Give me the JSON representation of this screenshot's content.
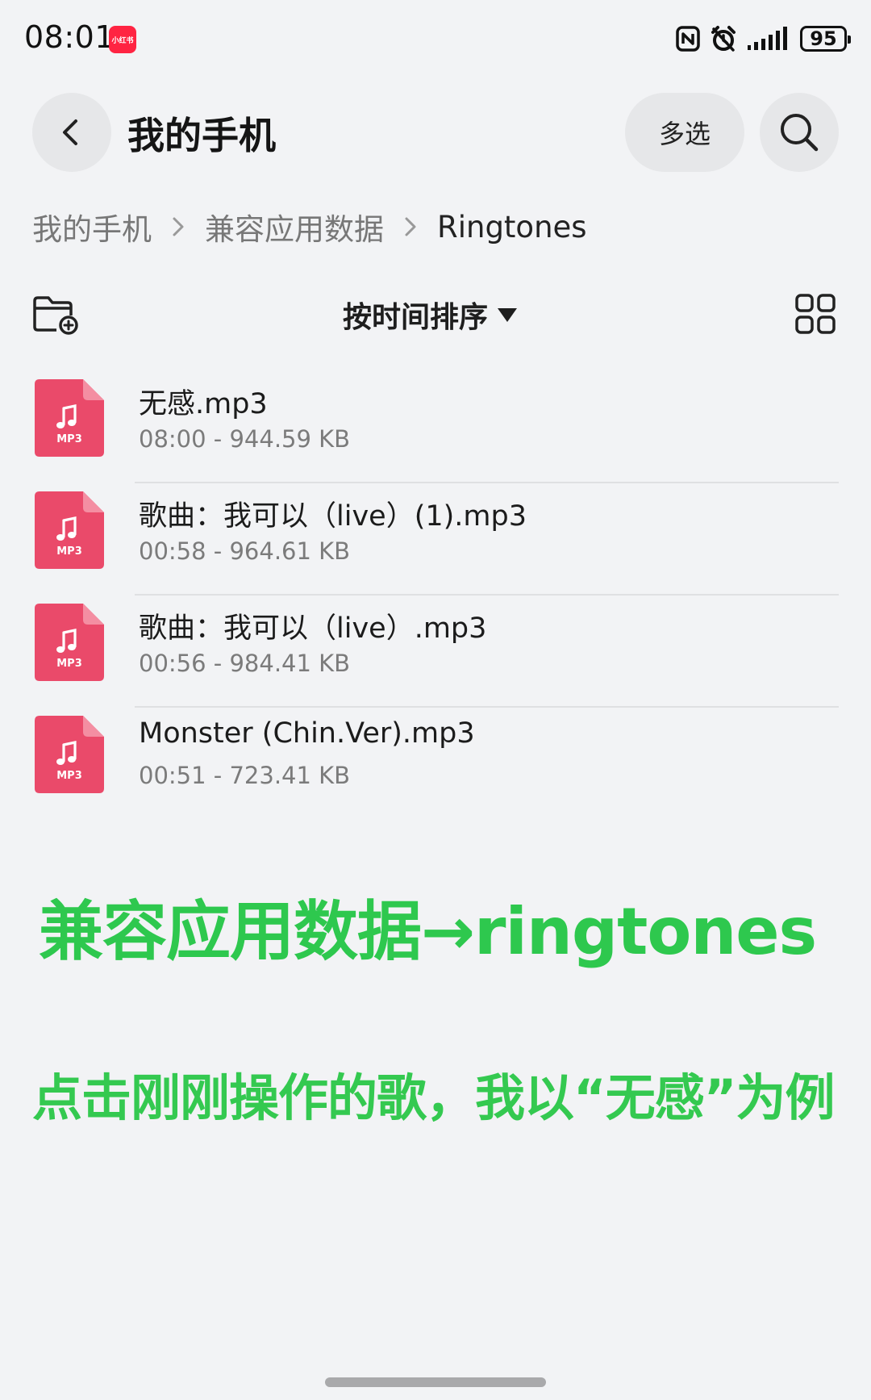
{
  "status_bar": {
    "time": "08:01",
    "app_badge": "小红书",
    "battery": "95",
    "icons": [
      "nfc-icon",
      "alarm-icon",
      "signal-icon",
      "battery-icon"
    ]
  },
  "header": {
    "title": "我的手机",
    "multi_select_label": "多选"
  },
  "breadcrumb": {
    "items": [
      "我的手机",
      "兼容应用数据",
      "Ringtones"
    ]
  },
  "toolbar": {
    "sort_label": "按时间排序"
  },
  "files": [
    {
      "name": "无感.mp3",
      "meta": "08:00 - 944.59 KB",
      "type": "MP3"
    },
    {
      "name": "歌曲：我可以（live）(1).mp3",
      "meta": "00:58 - 964.61 KB",
      "type": "MP3"
    },
    {
      "name": "歌曲：我可以（live）.mp3",
      "meta": "00:56 - 984.41 KB",
      "type": "MP3"
    },
    {
      "name": "Monster (Chin.Ver).mp3",
      "meta": "00:51 - 723.41 KB",
      "type": "MP3"
    }
  ],
  "annotations": {
    "line1": "兼容应用数据→ringtones",
    "line2": "点击刚刚操作的歌，我以“无感”为例"
  },
  "colors": {
    "background": "#f2f3f5",
    "file_icon": "#ea4a6a",
    "annotation_green": "#2ec84e",
    "pill_bg": "#e6e7e9"
  }
}
